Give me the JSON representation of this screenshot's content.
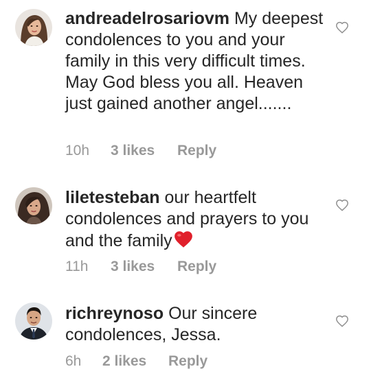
{
  "comments": [
    {
      "username": "andreadelrosariovm",
      "text": "My deepest condolences to you and your family in this very difficult times. May God bless you all. Heaven just gained another angel.......",
      "time": "10h",
      "likes": "3 likes",
      "reply": "Reply",
      "avatar_icon": "profile-photo-woman-long-hair",
      "like_icon": "heart-outline-icon"
    },
    {
      "username": "liletesteban",
      "text": "our heartfelt condolences and prayers to you and the family",
      "emoji": "red-heart-emoji",
      "time": "11h",
      "likes": "3 likes",
      "reply": "Reply",
      "avatar_icon": "profile-photo-woman-dark-hair",
      "like_icon": "heart-outline-icon"
    },
    {
      "username": "richreynoso",
      "text": "Our sincere condolences, Jessa.",
      "time": "6h",
      "likes": "2 likes",
      "reply": "Reply",
      "avatar_icon": "profile-photo-man-suit",
      "like_icon": "heart-outline-icon"
    }
  ],
  "colors": {
    "text": "#262626",
    "meta": "#999999",
    "icon_outline": "#8e8e8e",
    "emoji_heart": "#e0202b"
  }
}
